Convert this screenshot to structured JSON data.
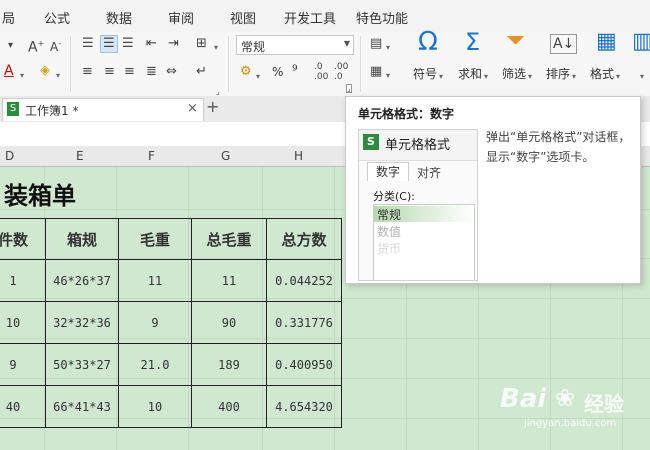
{
  "menu": [
    "局",
    "公式",
    "数据",
    "审阅",
    "视图",
    "开发工具",
    "特色功能"
  ],
  "ribbon": {
    "number_format": "常规",
    "percent": "%",
    "comma": "⁹",
    "buttons": {
      "symbol": "符号",
      "sum": "求和",
      "filter": "筛选",
      "sort": "排序",
      "format": "格式"
    }
  },
  "tabs": {
    "workbook": "工作簿1 *",
    "close": "×",
    "add": "+"
  },
  "columns": [
    "D",
    "E",
    "F",
    "G",
    "H"
  ],
  "sheet": {
    "title": "装箱单",
    "headers": [
      "件数",
      "箱规",
      "毛重",
      "总毛重",
      "总方数"
    ],
    "rows": [
      [
        "1",
        "46*26*37",
        "11",
        "11",
        "0.044252"
      ],
      [
        "10",
        "32*32*36",
        "9",
        "90",
        "0.331776"
      ],
      [
        "9",
        "50*33*27",
        "21.0",
        "189",
        "0.400950"
      ],
      [
        "40",
        "66*41*43",
        "10",
        "400",
        "4.654320"
      ]
    ]
  },
  "tooltip": {
    "title": "单元格格式：数字",
    "dialog_title": "单元格格式",
    "dialog_tabs": [
      "数字",
      "对齐"
    ],
    "category_label": "分类(C):",
    "categories": [
      "常规",
      "数值",
      "货币"
    ],
    "description": "弹出“单元格格式”对话框，显示“数字”选项卡。"
  },
  "watermark": {
    "brand": "Bai",
    "brand2": "经验",
    "url": "jingyan.baidu.com"
  },
  "colors": {
    "sheet_bg": "#cfe8cf",
    "accent_blue": "#1e73c8",
    "accent_orange": "#e8902a",
    "green_badge": "#2e8b3e"
  }
}
